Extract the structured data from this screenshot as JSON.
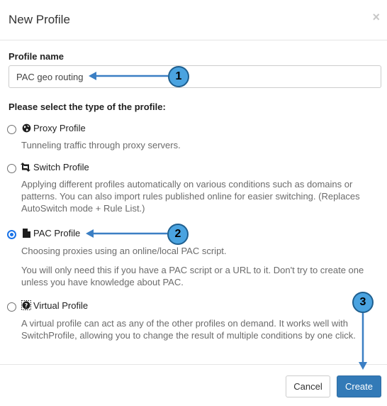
{
  "dialog": {
    "title": "New Profile",
    "close_label": "×"
  },
  "profile_name": {
    "label": "Profile name",
    "value": "PAC geo routing"
  },
  "type_prompt": "Please select the type of the profile:",
  "options": [
    {
      "label": "Proxy Profile",
      "icon": "globe-icon",
      "checked": false,
      "description": [
        "Tunneling traffic through proxy servers."
      ]
    },
    {
      "label": "Switch Profile",
      "icon": "retweet-icon",
      "checked": false,
      "description": [
        "Applying different profiles automatically on various conditions such as domains or patterns. You can also import rules published online for easier switching. (Replaces AutoSwitch mode + Rule List.)"
      ]
    },
    {
      "label": "PAC Profile",
      "icon": "file-icon",
      "checked": true,
      "description": [
        "Choosing proxies using an online/local PAC script.",
        "You will only need this if you have a PAC script or a URL to it. Don't try to create one unless you have knowledge about PAC."
      ]
    },
    {
      "label": "Virtual Profile",
      "icon": "question-circle-icon",
      "checked": false,
      "description": [
        "A virtual profile can act as any of the other profiles on demand. It works well with SwitchProfile, allowing you to change the result of multiple conditions by one click."
      ]
    }
  ],
  "footer": {
    "cancel_label": "Cancel",
    "create_label": "Create"
  },
  "annotations": [
    "1",
    "2",
    "3"
  ],
  "colors": {
    "primary": "#337ab7",
    "annotation_fill": "#4aa3e0",
    "annotation_arrow": "#3b7fc4",
    "radio_checked": "#1a73e8"
  }
}
